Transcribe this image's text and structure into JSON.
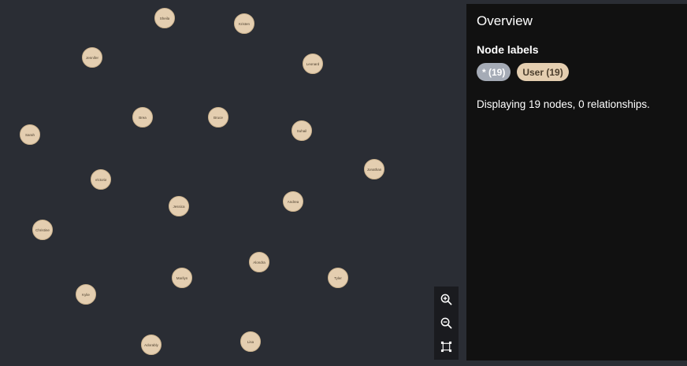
{
  "graph": {
    "nodes": [
      {
        "label": "Sheila"
      },
      {
        "label": "Kristen"
      },
      {
        "label": "Jennifer"
      },
      {
        "label": "Leonard"
      },
      {
        "label": "Brea"
      },
      {
        "label": "Bruce"
      },
      {
        "label": "Suhail"
      },
      {
        "label": "Sarah"
      },
      {
        "label": "Jonathan"
      },
      {
        "label": "Victoria"
      },
      {
        "label": "Jessica"
      },
      {
        "label": "Andrea"
      },
      {
        "label": "Christine"
      },
      {
        "label": "Alondra"
      },
      {
        "label": "Marilyn"
      },
      {
        "label": "Tyler"
      },
      {
        "label": "Kylie"
      },
      {
        "label": "Adorably"
      },
      {
        "label": "Lisa"
      }
    ],
    "node_color": "#e4ceb0",
    "background": "#2a2d34"
  },
  "zoom": {
    "zoom_in_icon": "zoom-in-icon",
    "zoom_out_icon": "zoom-out-icon",
    "fit_icon": "fit-to-screen-icon"
  },
  "panel": {
    "title": "Overview",
    "node_labels_heading": "Node labels",
    "chips": [
      {
        "label": "* (19)",
        "color": "#a5abb6"
      },
      {
        "label": "User (19)",
        "color": "#e4ceb0"
      }
    ],
    "summary": "Displaying 19 nodes, 0 relationships."
  }
}
